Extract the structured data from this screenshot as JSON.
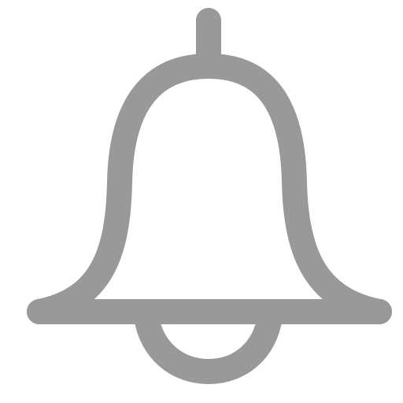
{
  "icon": {
    "name": "bell-icon",
    "stroke_color": "#999999",
    "background_color": "#ffffff"
  }
}
